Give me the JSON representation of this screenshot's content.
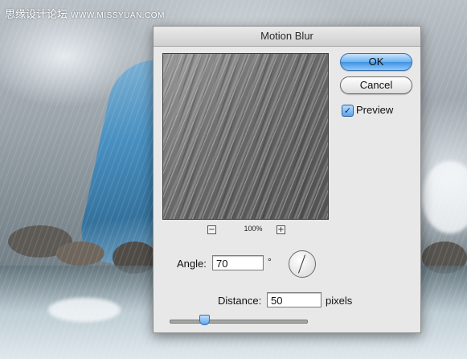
{
  "background": {
    "watermark_text": "思缘设计论坛",
    "watermark_site": "WWW.MISSYUAN.COM"
  },
  "dialog": {
    "title": "Motion Blur",
    "zoom": {
      "level": "100%",
      "minus_symbol": "−",
      "plus_symbol": "+"
    },
    "buttons": {
      "ok_label": "OK",
      "cancel_label": "Cancel"
    },
    "preview": {
      "label": "Preview",
      "checked": true,
      "check_glyph": "✓"
    },
    "angle": {
      "label": "Angle:",
      "value": "70",
      "unit": "°"
    },
    "distance": {
      "label": "Distance:",
      "value": "50",
      "unit": "pixels",
      "slider_fraction": 0.25
    },
    "colors": {
      "ok_button": "#4a9ae6",
      "checkbox": "#5aa4ea"
    }
  }
}
